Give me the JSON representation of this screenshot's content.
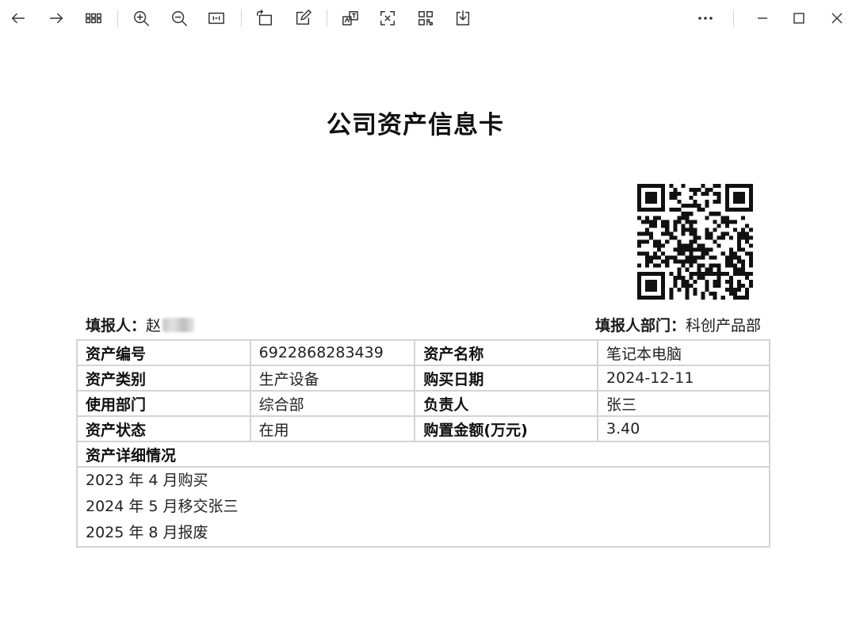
{
  "toolbar": {
    "icons": [
      "arrow-left-icon",
      "arrow-right-icon",
      "grid-icon",
      "zoom-in-icon",
      "zoom-out-icon",
      "fit-width-icon",
      "rotate-icon",
      "edit-icon",
      "translate-icon",
      "scan-text-icon",
      "qr-code-icon",
      "download-icon",
      "more-icon"
    ],
    "window_controls": [
      "minimize-icon",
      "maximize-icon",
      "close-icon"
    ]
  },
  "document": {
    "title": "公司资产信息卡",
    "reporter_label": "填报人：",
    "reporter_value": "赵",
    "department_label": "填报人部门：",
    "department_value": "科创产品部",
    "rows": [
      {
        "label1": "资产编号",
        "value1": "6922868283439",
        "label2": "资产名称",
        "value2": "笔记本电脑"
      },
      {
        "label1": "资产类别",
        "value1": "生产设备",
        "label2": "购买日期",
        "value2": "2024-12-11"
      },
      {
        "label1": "使用部门",
        "value1": "综合部",
        "label2": "负责人",
        "value2": "张三"
      },
      {
        "label1": "资产状态",
        "value1": "在用",
        "label2": "购置金额(万元)",
        "value2": "3.40"
      }
    ],
    "detail_label": "资产详细情况",
    "detail_lines": [
      "2023 年 4 月购买",
      "2024 年 5 月移交张三",
      "2025 年 8 月报废"
    ]
  }
}
